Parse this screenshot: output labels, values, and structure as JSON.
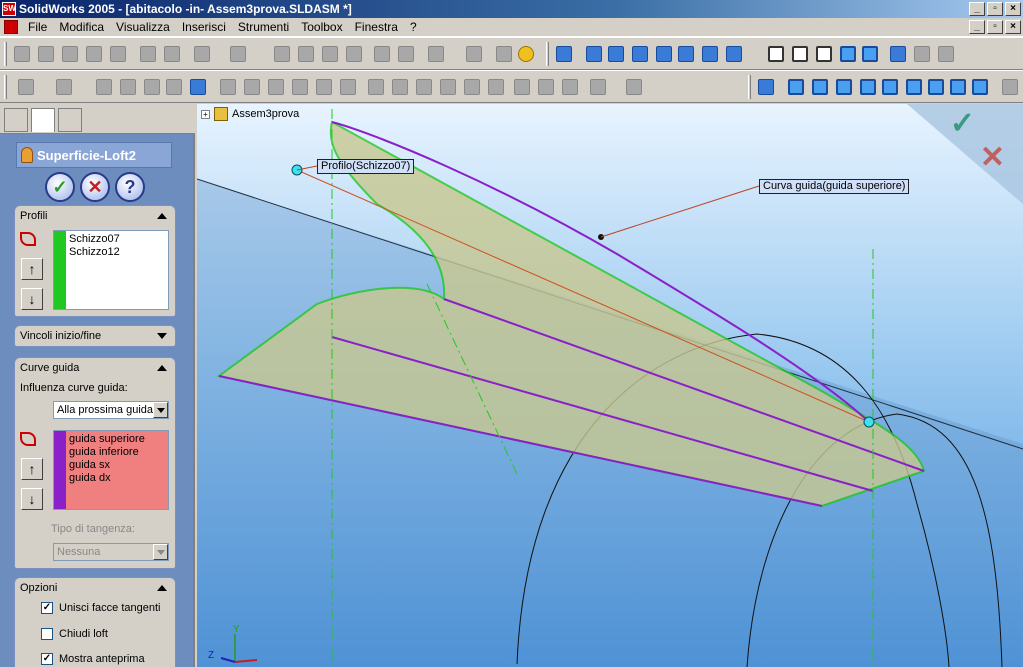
{
  "window": {
    "title": "SolidWorks 2005 - [abitacolo -in- Assem3prova.SLDASM *]"
  },
  "menu": {
    "items": [
      "File",
      "Modifica",
      "Visualizza",
      "Inserisci",
      "Strumenti",
      "Toolbox",
      "Finestra",
      "?"
    ]
  },
  "feature": {
    "title": "Superficie-Loft2"
  },
  "profili": {
    "title": "Profili",
    "items": [
      "Schizzo07",
      "Schizzo12"
    ]
  },
  "vincoli": {
    "title": "Vincoli inizio/fine"
  },
  "curve": {
    "title": "Curve guida",
    "influence_label": "Influenza curve guida:",
    "influence_value": "Alla prossima guida",
    "items": [
      "guida superiore",
      "guida inferiore",
      "guida sx",
      "guida dx"
    ],
    "tangency_label": "Tipo di tangenza:",
    "tangency_value": "Nessuna"
  },
  "opzioni": {
    "title": "Opzioni",
    "options": [
      {
        "label": "Unisci facce tangenti",
        "checked": true
      },
      {
        "label": "Chiudi loft",
        "checked": false
      },
      {
        "label": "Mostra anteprima",
        "checked": true
      }
    ]
  },
  "viewport": {
    "tree_root": "Assem3prova",
    "callout_profile": "Profilo(Schizzo07)",
    "callout_guide": "Curva guida(guida superiore)",
    "axis_y": "Y",
    "axis_z": "Z"
  },
  "colors": {
    "profile_green": "#22c822",
    "guide_purple": "#8a20c8",
    "surface": "#c8c890",
    "sky": "#9ccaf0"
  }
}
